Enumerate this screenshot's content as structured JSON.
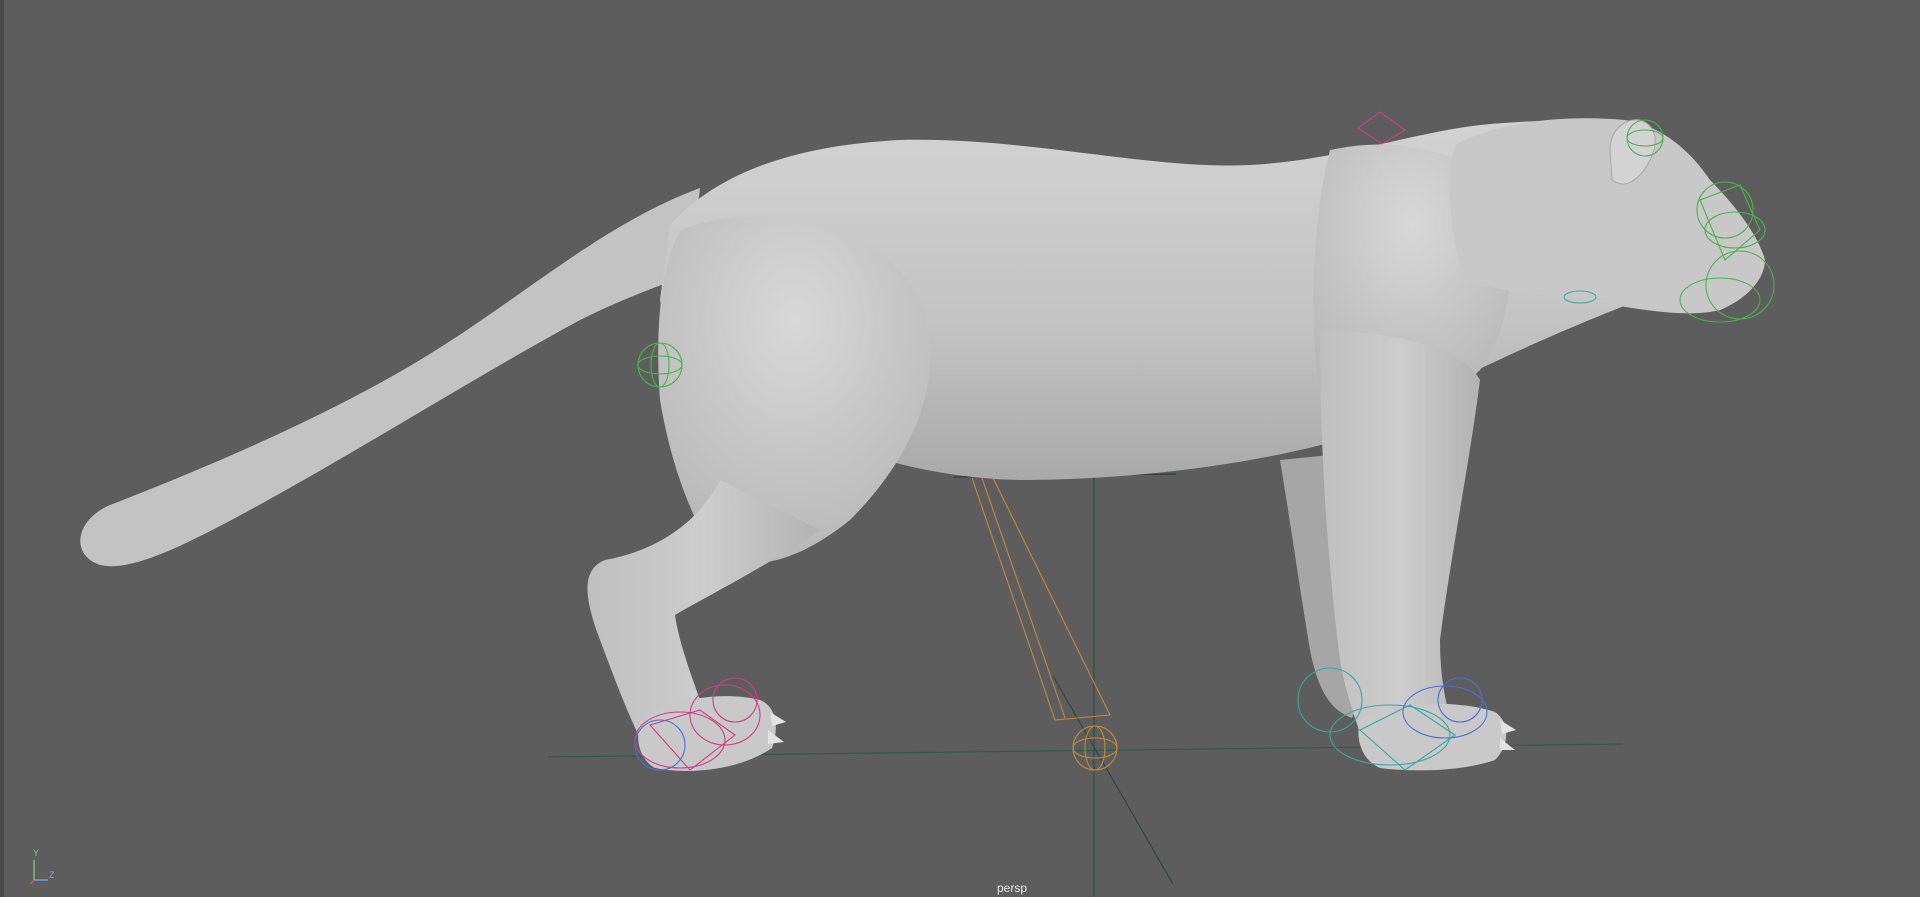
{
  "viewport": {
    "camera_label": "persp",
    "axis_y": "Y",
    "axis_z": "Z"
  },
  "icons": {
    "axis_gizmo": "axis-gizmo-icon"
  },
  "colors": {
    "background": "#5d5d5d",
    "model": "#c4c4c4",
    "grid_x": "#2e5a4e",
    "grid_y": "#2c4a44",
    "control_green": "#49b34a",
    "control_magenta": "#cc3f86",
    "control_blue": "#4a6fd6",
    "control_cyan": "#37a7a6",
    "control_orange": "#c5873a",
    "axis_y": "#7fd07f",
    "axis_z": "#6fa6ff",
    "axis_x": "#e05050"
  }
}
